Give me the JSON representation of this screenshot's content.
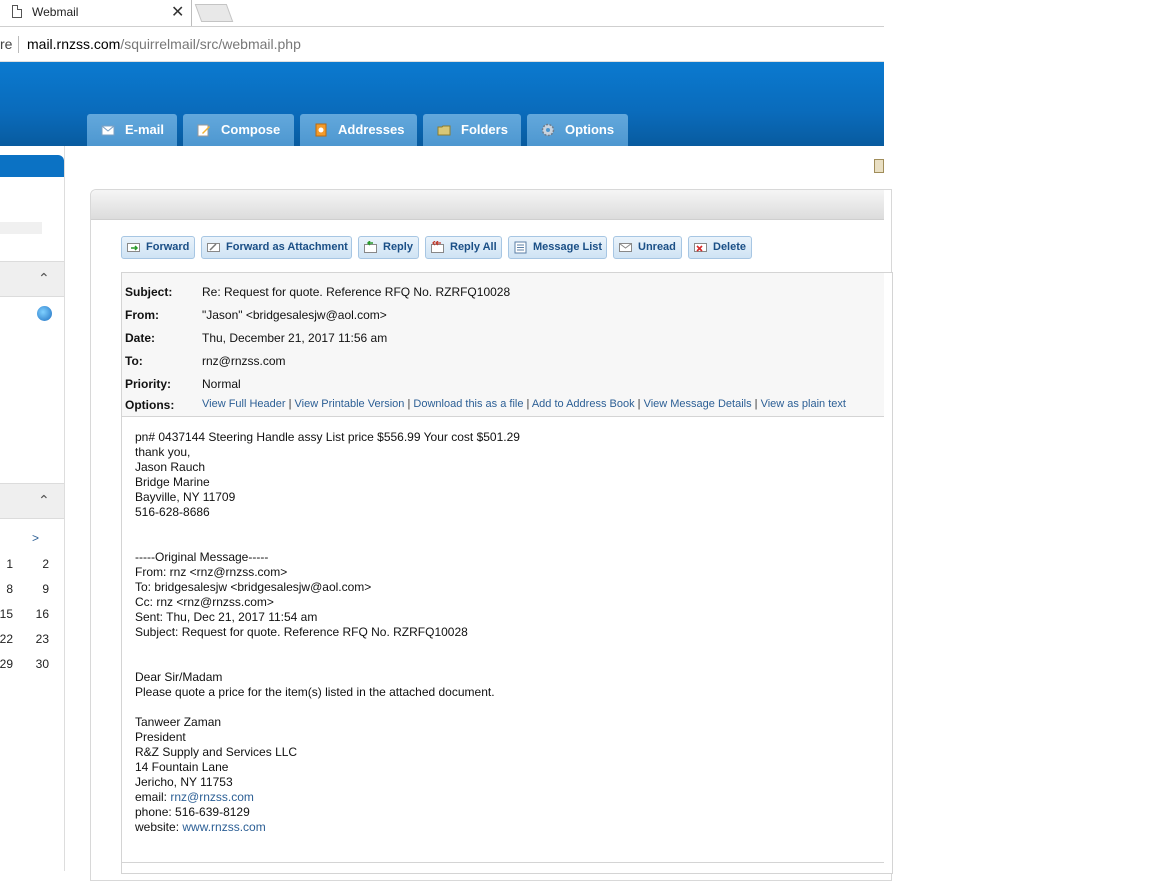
{
  "browser": {
    "tab_title": "Webmail",
    "close_glyph": "✕",
    "url_prefix_fragment": "re",
    "url_host": "mail.rnzss.com",
    "url_path": "/squirrelmail/src/webmail.php"
  },
  "nav": {
    "tabs": [
      {
        "label": "E-mail",
        "icon": "mail-icon"
      },
      {
        "label": "Compose",
        "icon": "compose-icon"
      },
      {
        "label": "Addresses",
        "icon": "address-book-icon"
      },
      {
        "label": "Folders",
        "icon": "folder-icon"
      },
      {
        "label": "Options",
        "icon": "gear-icon"
      }
    ]
  },
  "sidebar": {
    "calendar_next": ">",
    "calendar_days": [
      "1",
      "2",
      "8",
      "9",
      "15",
      "16",
      "22",
      "23",
      "29",
      "30"
    ],
    "collapse_glyph": "⌃"
  },
  "actions": [
    {
      "label": "Forward",
      "icon": "forward-icon"
    },
    {
      "label": "Forward as Attachment",
      "icon": "forward-attachment-icon"
    },
    {
      "label": "Reply",
      "icon": "reply-icon"
    },
    {
      "label": "Reply All",
      "icon": "reply-all-icon"
    },
    {
      "label": "Message List",
      "icon": "message-list-icon"
    },
    {
      "label": "Unread",
      "icon": "unread-icon"
    },
    {
      "label": "Delete",
      "icon": "delete-icon"
    }
  ],
  "message": {
    "labels": {
      "subject": "Subject:",
      "from": "From:",
      "date": "Date:",
      "to": "To:",
      "priority": "Priority:",
      "options": "Options:"
    },
    "subject": "Re: Request for quote. Reference RFQ No. RZRFQ10028",
    "from": "\"Jason\" <bridgesalesjw@aol.com>",
    "date": "Thu, December 21, 2017 11:56 am",
    "to": "rnz@rnzss.com",
    "priority": "Normal",
    "option_links": [
      "View Full Header",
      "View Printable Version",
      "Download this as a file",
      "Add to Address Book",
      "View Message Details",
      "View as plain text"
    ],
    "body_lines": [
      "pn# 0437144 Steering Handle assy List price $556.99 Your cost $501.29",
      "thank you,",
      "Jason Rauch",
      "Bridge Marine",
      "Bayville, NY 11709",
      "516-628-8686",
      "",
      "",
      "-----Original Message-----",
      "From: rnz <rnz@rnzss.com>",
      "To: bridgesalesjw <bridgesalesjw@aol.com>",
      "Cc: rnz <rnz@rnzss.com>",
      "Sent: Thu, Dec 21, 2017 11:54 am",
      "Subject: Request for quote. Reference RFQ No. RZRFQ10028",
      "",
      "",
      "Dear Sir/Madam",
      "Please quote a price for the item(s) listed in the attached document.",
      "",
      "Tanweer Zaman",
      "President",
      "R&Z Supply and Services LLC",
      "14 Fountain Lane",
      "Jericho, NY 11753"
    ],
    "email_label": "email: ",
    "email_link": "rnz@rnzss.com",
    "phone_line": "phone: 516-639-8129",
    "website_label": "website: ",
    "website_link": "www.rnzss.com"
  },
  "colors": {
    "header_blue": "#0a6bbb",
    "tab_blue": "#4d97d0",
    "link_blue": "#2c5f95"
  }
}
